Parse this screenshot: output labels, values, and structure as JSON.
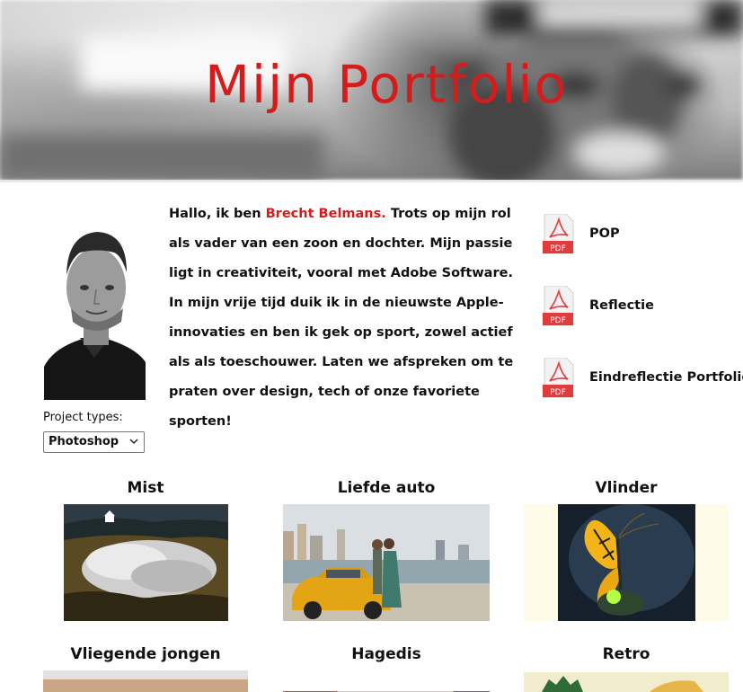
{
  "header": {
    "title": "Mijn Portfolio"
  },
  "intro": {
    "prefix": "Hallo, ik ben ",
    "name": "Brecht Belmans.",
    "text": " Trots op mijn rol als vader van een zoon en dochter. Mijn passie ligt in creativiteit, vooral met Adobe Software. In mijn vrije tijd duik ik in de nieuwste Apple-innovaties en ben ik gek op sport, zowel actief als als toeschouwer. Laten we afspreken om te praten over design, tech of onze favoriete sporten!"
  },
  "filter": {
    "label": "Project types:",
    "selected": "Photoshop"
  },
  "documents": [
    {
      "label": "POP",
      "icon": "pdf-icon",
      "badge": "PDF"
    },
    {
      "label": "Reflectie",
      "icon": "pdf-icon",
      "badge": "PDF"
    },
    {
      "label": "Eindreflectie Portfolio",
      "icon": "pdf-icon",
      "badge": "PDF"
    }
  ],
  "projects": [
    {
      "title": "Mist"
    },
    {
      "title": "Liefde auto"
    },
    {
      "title": "Vlinder"
    },
    {
      "title": "Vliegende jongen"
    },
    {
      "title": "Hagedis"
    },
    {
      "title": "Retro"
    }
  ],
  "colors": {
    "accent": "#d31d1d",
    "pdf_red": "#e03c3c"
  }
}
